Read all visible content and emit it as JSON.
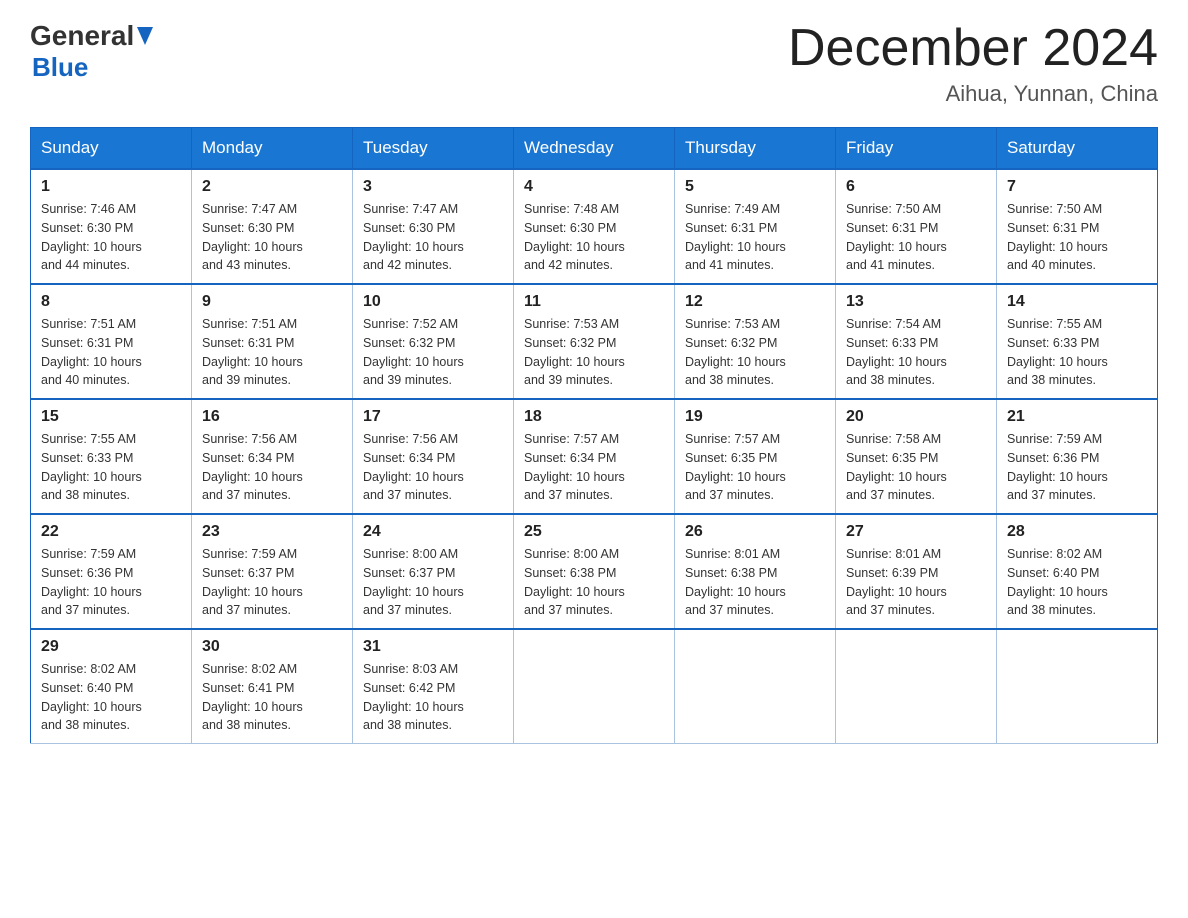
{
  "header": {
    "logo_general": "General",
    "logo_blue": "Blue",
    "month_year": "December 2024",
    "location": "Aihua, Yunnan, China"
  },
  "days_of_week": [
    "Sunday",
    "Monday",
    "Tuesday",
    "Wednesday",
    "Thursday",
    "Friday",
    "Saturday"
  ],
  "weeks": [
    [
      {
        "day": "1",
        "sunrise": "7:46 AM",
        "sunset": "6:30 PM",
        "daylight": "10 hours and 44 minutes."
      },
      {
        "day": "2",
        "sunrise": "7:47 AM",
        "sunset": "6:30 PM",
        "daylight": "10 hours and 43 minutes."
      },
      {
        "day": "3",
        "sunrise": "7:47 AM",
        "sunset": "6:30 PM",
        "daylight": "10 hours and 42 minutes."
      },
      {
        "day": "4",
        "sunrise": "7:48 AM",
        "sunset": "6:30 PM",
        "daylight": "10 hours and 42 minutes."
      },
      {
        "day": "5",
        "sunrise": "7:49 AM",
        "sunset": "6:31 PM",
        "daylight": "10 hours and 41 minutes."
      },
      {
        "day": "6",
        "sunrise": "7:50 AM",
        "sunset": "6:31 PM",
        "daylight": "10 hours and 41 minutes."
      },
      {
        "day": "7",
        "sunrise": "7:50 AM",
        "sunset": "6:31 PM",
        "daylight": "10 hours and 40 minutes."
      }
    ],
    [
      {
        "day": "8",
        "sunrise": "7:51 AM",
        "sunset": "6:31 PM",
        "daylight": "10 hours and 40 minutes."
      },
      {
        "day": "9",
        "sunrise": "7:51 AM",
        "sunset": "6:31 PM",
        "daylight": "10 hours and 39 minutes."
      },
      {
        "day": "10",
        "sunrise": "7:52 AM",
        "sunset": "6:32 PM",
        "daylight": "10 hours and 39 minutes."
      },
      {
        "day": "11",
        "sunrise": "7:53 AM",
        "sunset": "6:32 PM",
        "daylight": "10 hours and 39 minutes."
      },
      {
        "day": "12",
        "sunrise": "7:53 AM",
        "sunset": "6:32 PM",
        "daylight": "10 hours and 38 minutes."
      },
      {
        "day": "13",
        "sunrise": "7:54 AM",
        "sunset": "6:33 PM",
        "daylight": "10 hours and 38 minutes."
      },
      {
        "day": "14",
        "sunrise": "7:55 AM",
        "sunset": "6:33 PM",
        "daylight": "10 hours and 38 minutes."
      }
    ],
    [
      {
        "day": "15",
        "sunrise": "7:55 AM",
        "sunset": "6:33 PM",
        "daylight": "10 hours and 38 minutes."
      },
      {
        "day": "16",
        "sunrise": "7:56 AM",
        "sunset": "6:34 PM",
        "daylight": "10 hours and 37 minutes."
      },
      {
        "day": "17",
        "sunrise": "7:56 AM",
        "sunset": "6:34 PM",
        "daylight": "10 hours and 37 minutes."
      },
      {
        "day": "18",
        "sunrise": "7:57 AM",
        "sunset": "6:34 PM",
        "daylight": "10 hours and 37 minutes."
      },
      {
        "day": "19",
        "sunrise": "7:57 AM",
        "sunset": "6:35 PM",
        "daylight": "10 hours and 37 minutes."
      },
      {
        "day": "20",
        "sunrise": "7:58 AM",
        "sunset": "6:35 PM",
        "daylight": "10 hours and 37 minutes."
      },
      {
        "day": "21",
        "sunrise": "7:59 AM",
        "sunset": "6:36 PM",
        "daylight": "10 hours and 37 minutes."
      }
    ],
    [
      {
        "day": "22",
        "sunrise": "7:59 AM",
        "sunset": "6:36 PM",
        "daylight": "10 hours and 37 minutes."
      },
      {
        "day": "23",
        "sunrise": "7:59 AM",
        "sunset": "6:37 PM",
        "daylight": "10 hours and 37 minutes."
      },
      {
        "day": "24",
        "sunrise": "8:00 AM",
        "sunset": "6:37 PM",
        "daylight": "10 hours and 37 minutes."
      },
      {
        "day": "25",
        "sunrise": "8:00 AM",
        "sunset": "6:38 PM",
        "daylight": "10 hours and 37 minutes."
      },
      {
        "day": "26",
        "sunrise": "8:01 AM",
        "sunset": "6:38 PM",
        "daylight": "10 hours and 37 minutes."
      },
      {
        "day": "27",
        "sunrise": "8:01 AM",
        "sunset": "6:39 PM",
        "daylight": "10 hours and 37 minutes."
      },
      {
        "day": "28",
        "sunrise": "8:02 AM",
        "sunset": "6:40 PM",
        "daylight": "10 hours and 38 minutes."
      }
    ],
    [
      {
        "day": "29",
        "sunrise": "8:02 AM",
        "sunset": "6:40 PM",
        "daylight": "10 hours and 38 minutes."
      },
      {
        "day": "30",
        "sunrise": "8:02 AM",
        "sunset": "6:41 PM",
        "daylight": "10 hours and 38 minutes."
      },
      {
        "day": "31",
        "sunrise": "8:03 AM",
        "sunset": "6:42 PM",
        "daylight": "10 hours and 38 minutes."
      },
      null,
      null,
      null,
      null
    ]
  ],
  "labels": {
    "sunrise": "Sunrise:",
    "sunset": "Sunset:",
    "daylight": "Daylight:"
  }
}
